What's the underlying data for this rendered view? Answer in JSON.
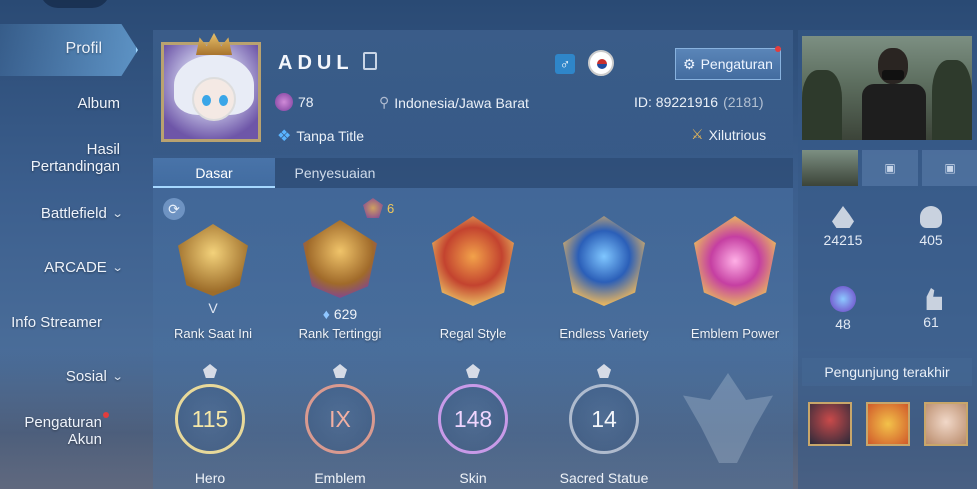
{
  "sidebar": {
    "items": [
      {
        "label": "Profil",
        "active": true
      },
      {
        "label": "Album"
      },
      {
        "label": "Hasil Pertandingan"
      },
      {
        "label": "Battlefield",
        "has_chevron": true
      },
      {
        "label": "ARCADE",
        "has_chevron": true
      },
      {
        "label": "Info Streamer"
      },
      {
        "label": "Sosial",
        "has_chevron": true
      },
      {
        "label": "Pengaturan Akun",
        "notification": true
      }
    ]
  },
  "profile": {
    "name": "ADUL",
    "level_badge": "78",
    "location": "Indonesia/Jawa Barat",
    "id_label": "ID: 89221916",
    "server": "(2181)",
    "title": "Tanpa Title",
    "squad": "Xilutrious",
    "gender_icon": "♂",
    "settings_label": "Pengaturan"
  },
  "tabs": [
    {
      "label": "Dasar",
      "active": true
    },
    {
      "label": "Penyesuaian"
    }
  ],
  "ranks": [
    {
      "label": "Rank Saat Ini",
      "tier": "V"
    },
    {
      "label": "Rank Tertinggi",
      "points": "629",
      "badge_count": "6"
    },
    {
      "label": "Regal Style"
    },
    {
      "label": "Endless Variety"
    },
    {
      "label": "Emblem Power"
    }
  ],
  "stats": [
    {
      "label": "Hero",
      "value": "115"
    },
    {
      "label": "Emblem",
      "value": "IX"
    },
    {
      "label": "Skin",
      "value": "148"
    },
    {
      "label": "Sacred Statue",
      "value": "14"
    }
  ],
  "right_panel": {
    "popularity": "24215",
    "followers": "405",
    "charm": "48",
    "likes": "61",
    "recent_visitors_label": "Pengunjung terakhir"
  },
  "colors": {
    "accent": "#a6d8ff",
    "gold": "#c8a66a",
    "notification": "#e23d3d",
    "hero_circle": "#f0d27a",
    "emblem_circle": "#e07a6a",
    "skin_circle": "#c78bef"
  }
}
